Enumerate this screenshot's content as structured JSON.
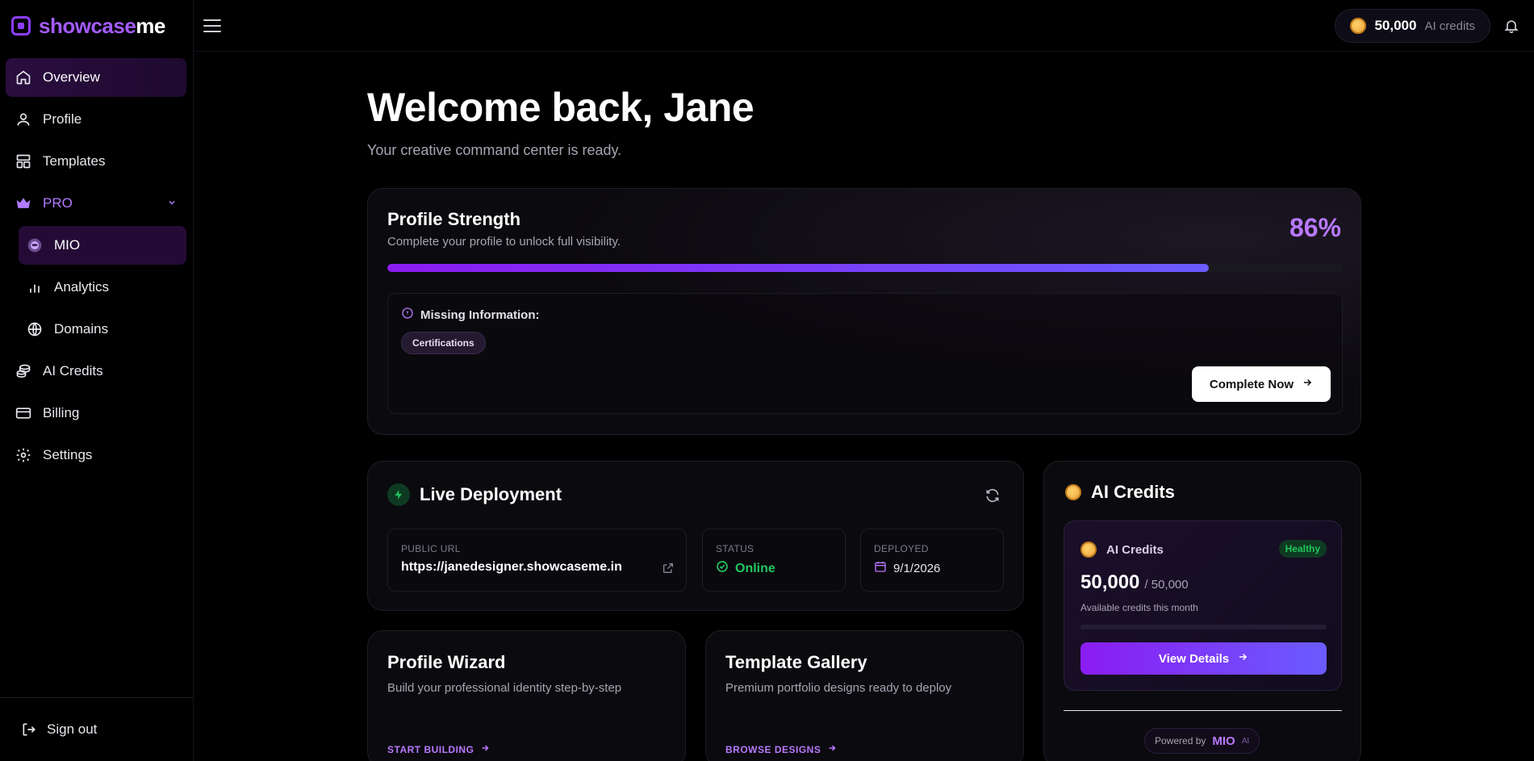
{
  "brand": {
    "name_a": "showcase",
    "name_b": "me"
  },
  "sidebar": {
    "items": [
      {
        "label": "Overview",
        "icon": "home-icon"
      },
      {
        "label": "Profile",
        "icon": "user-icon"
      },
      {
        "label": "Templates",
        "icon": "templates-icon"
      },
      {
        "label": "PRO",
        "icon": "crown-icon"
      },
      {
        "label": "MIO",
        "icon": "mio-icon"
      },
      {
        "label": "Analytics",
        "icon": "bar-chart-icon"
      },
      {
        "label": "Domains",
        "icon": "globe-icon"
      },
      {
        "label": "AI Credits",
        "icon": "coins-icon"
      },
      {
        "label": "Billing",
        "icon": "credit-card-icon"
      },
      {
        "label": "Settings",
        "icon": "gear-icon"
      }
    ],
    "signout": "Sign out"
  },
  "topbar": {
    "credits_value": "50,000",
    "credits_label": "AI credits"
  },
  "welcome": {
    "title": "Welcome back, Jane",
    "subtitle": "Your creative command center is ready."
  },
  "strength": {
    "title": "Profile Strength",
    "desc": "Complete your profile to unlock full visibility.",
    "percent_label": "86%",
    "percent": 86,
    "missing_label": "Missing Information:",
    "missing_tags": [
      "Certifications"
    ],
    "cta": "Complete Now"
  },
  "deploy": {
    "title": "Live Deployment",
    "url_key": "PUBLIC URL",
    "url": "https://janedesigner.showcaseme.in",
    "status_key": "STATUS",
    "status": "Online",
    "deployed_key": "DEPLOYED",
    "deployed": "9/1/2026"
  },
  "wizard": {
    "title": "Profile Wizard",
    "desc": "Build your professional identity step-by-step",
    "link": "START BUILDING"
  },
  "gallery": {
    "title": "Template Gallery",
    "desc": "Premium portfolio designs ready to deploy",
    "link": "BROWSE DESIGNS"
  },
  "credits": {
    "title": "AI Credits",
    "card_label": "AI Credits",
    "badge": "Healthy",
    "value": "50,000",
    "total": "/ 50,000",
    "avail": "Available credits this month",
    "usage_fraction": 0,
    "cta": "View Details",
    "powered_by": "Powered by",
    "powered_name": "MIO",
    "powered_ai": "AI"
  },
  "colors": {
    "accent": "#a45bff",
    "success": "#22c55e",
    "progress_start": "#8b1cf2",
    "progress_end": "#6a5cff"
  }
}
